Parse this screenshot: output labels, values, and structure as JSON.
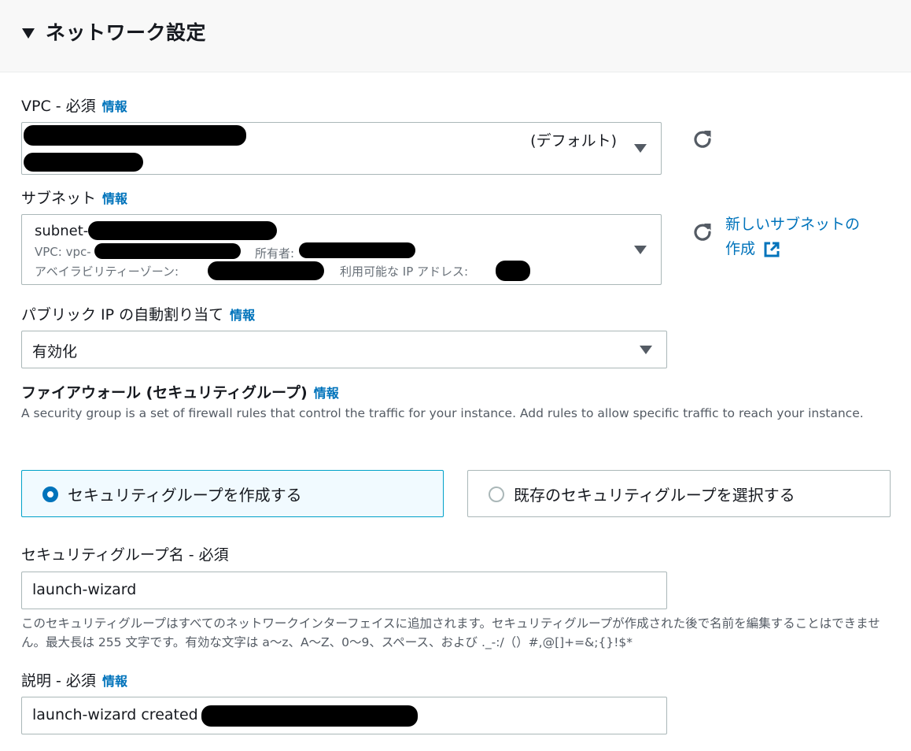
{
  "section": {
    "title": "ネットワーク設定"
  },
  "vpc": {
    "label": "VPC - 必須",
    "info": "情報",
    "value_suffix": "(デフォルト)"
  },
  "subnet": {
    "label": "サブネット",
    "info": "情報",
    "name_prefix": "subnet-",
    "vpc_prefix": "VPC: vpc-",
    "owner_label": "所有者:",
    "az_label": "アベイラビリティーゾーン:",
    "ip_label": "利用可能な IP アドレス:",
    "create_link_line1": "新しいサブネットの",
    "create_link_line2": "作成"
  },
  "public_ip": {
    "label": "パブリック IP の自動割り当て",
    "info": "情報",
    "value": "有効化"
  },
  "firewall": {
    "label": "ファイアウォール (セキュリティグループ)",
    "info": "情報",
    "description": "A security group is a set of firewall rules that control the traffic for your instance. Add rules to allow specific traffic to reach your instance.",
    "option_create": "セキュリティグループを作成する",
    "option_existing": "既存のセキュリティグループを選択する"
  },
  "sg_name": {
    "label": "セキュリティグループ名 - 必須",
    "value": "launch-wizard",
    "hint": "このセキュリティグループはすべてのネットワークインターフェイスに追加されます。セキュリティグループが作成された後で名前を編集することはできません。最大長は 255 文字です。有効な文字は a〜z、A〜Z、0〜9、スペース、および ._-:/（）#,@[]+=&;{}!$*"
  },
  "description_field": {
    "label": "説明 - 必須",
    "info": "情報",
    "value": "launch-wizard created "
  },
  "colors": {
    "accent": "#0073bb",
    "selected_border": "#00a1c9",
    "selected_bg": "#f1faff",
    "border": "#aab7b8"
  },
  "icons": [
    "caret-down-icon",
    "refresh-icon",
    "external-link-icon",
    "dropdown-arrow-icon"
  ]
}
